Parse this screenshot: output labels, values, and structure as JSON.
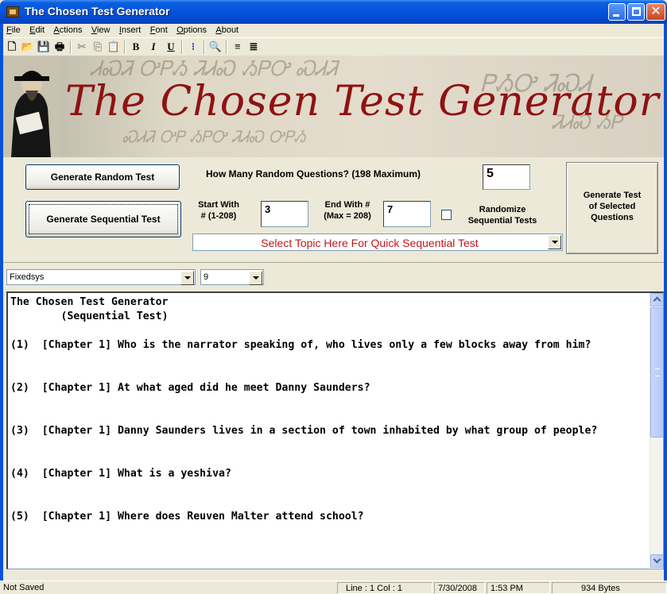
{
  "window": {
    "title": "The Chosen Test Generator"
  },
  "menu": {
    "items": [
      {
        "mnemonic": "F",
        "rest": "ile"
      },
      {
        "mnemonic": "E",
        "rest": "dit"
      },
      {
        "mnemonic": "A",
        "rest": "ctions"
      },
      {
        "mnemonic": "V",
        "rest": "iew"
      },
      {
        "mnemonic": "I",
        "rest": "nsert"
      },
      {
        "mnemonic": "F",
        "rest": "ont"
      },
      {
        "mnemonic": "O",
        "rest": "ptions"
      },
      {
        "mnemonic": "A",
        "rest": "bout"
      }
    ]
  },
  "toolbar": {
    "new_glyph": "🗋",
    "open_glyph": "📂",
    "save_glyph": "💾",
    "print_glyph": "🖶",
    "cut_glyph": "✂",
    "copy_glyph": "⎘",
    "paste_glyph": "📋",
    "bold_glyph": "B",
    "italic_glyph": "I",
    "underline_glyph": "U",
    "bullets_glyph": "⁝",
    "find_glyph": "🔍",
    "align_left_glyph": "≡",
    "align_center_glyph": "≣"
  },
  "banner": {
    "title": "The Chosen Test Generator"
  },
  "controls": {
    "generate_random_label": "Generate Random Test",
    "generate_sequential_label": "Generate Sequential Test",
    "how_many_label": "How Many Random Questions? (198 Maximum)",
    "how_many_value": "5",
    "start_with_label_1": "Start With",
    "start_with_label_2": "# (1-208)",
    "start_with_value": "3",
    "end_with_label_1": "End With #",
    "end_with_label_2": "(Max = 208)",
    "end_with_value": "7",
    "randomize_label_1": "Randomize",
    "randomize_label_2": "Sequential Tests",
    "randomize_checked": false,
    "topic_placeholder": "Select Topic Here For Quick Sequential Test",
    "generate_selected_label_1": "Generate Test",
    "generate_selected_label_2": "of Selected",
    "generate_selected_label_3": "Questions"
  },
  "fontbar": {
    "font_name": "Fixedsys",
    "font_size": "9"
  },
  "editor": {
    "text": "The Chosen Test Generator\n        (Sequential Test)\n\n(1)  [Chapter 1] Who is the narrator speaking of, who lives only a few blocks away from him?\n\n\n(2)  [Chapter 1] At what aged did he meet Danny Saunders?\n\n\n(3)  [Chapter 1] Danny Saunders lives in a section of town inhabited by what group of people?\n\n\n(4)  [Chapter 1] What is a yeshiva?\n\n\n(5)  [Chapter 1] Where does Reuven Malter attend school?"
  },
  "status": {
    "saved": "Not Saved",
    "position": "Line : 1   Col : 1",
    "date": "7/30/2008",
    "time": "1:53 PM",
    "size": "934 Bytes"
  },
  "colors": {
    "titlebar": "#0553dc",
    "banner_title": "#8f1212",
    "topic_text": "#c4161c"
  }
}
